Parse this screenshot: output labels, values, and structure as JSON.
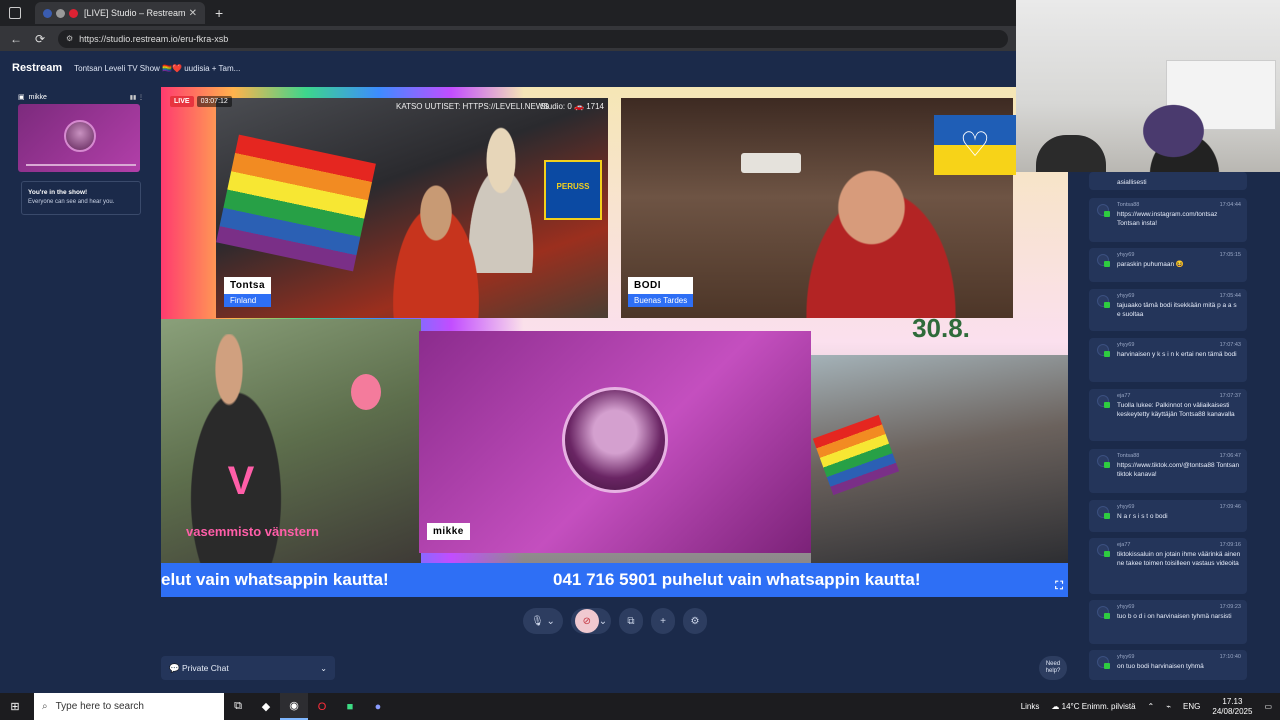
{
  "browser": {
    "tab_title": "[LIVE] Studio – Restream",
    "url": "https://studio.restream.io/eru-fkra-xsb"
  },
  "header": {
    "logo": "Restream",
    "show_title": "Tontsan Leveli TV Show 🏳️‍🌈❤️ uudisia + Tam..."
  },
  "sidebar": {
    "guest_name": "mikke",
    "note_title": "You're in the show!",
    "note_text": "Everyone can see and hear you."
  },
  "stage": {
    "live_label": "LIVE",
    "timer": "03:07:12",
    "tontsa_overlay": "KATSO UUTISET: HTTPS://LEVELI.NEWS",
    "tontsa_studio": "Studio: 0 🚗 1714",
    "perus_text": "PERUSS",
    "participants": [
      {
        "name": "Tontsa",
        "subtitle": "Finland"
      },
      {
        "name": "BODI",
        "subtitle": "Buenas Tardes"
      },
      {
        "name": "mikke",
        "subtitle": ""
      }
    ],
    "date_text": "30.8.",
    "logo_text": "vasemmisto vänstern",
    "ticker_left": "elut vain whatsappin kautta!",
    "ticker_right": "041 716 5901 puhelut vain whatsappin kautta!"
  },
  "controls": {
    "private_chat": "Private Chat",
    "need_help": "Need help?"
  },
  "chat": [
    {
      "user": "",
      "time": "",
      "text": "asiallisesti"
    },
    {
      "user": "Tontsa88",
      "time": "17:04:44",
      "text": "https://www.instagram.com/tontsaz Tontsan insta!"
    },
    {
      "user": "yhyy69",
      "time": "17:05:15",
      "text": "paraskin puhumaan 😆"
    },
    {
      "user": "yhyy69",
      "time": "17:05:44",
      "text": "tajuaako tämä bodi itsekkään mitä p a a s e suoltaa"
    },
    {
      "user": "yhyy69",
      "time": "17:07:43",
      "text": "harvinaisen y k s i n k ertai nen tämä bodi"
    },
    {
      "user": "eja77",
      "time": "17:07:37",
      "text": "Tuolla lukee: Palkinnot on väliaikaisesti keskeytetty käyttäjän Tontsa88 kanavalla"
    },
    {
      "user": "Tontsa88",
      "time": "17:06:47",
      "text": "https://www.tiktok.com/@tontsa88 Tontsan tiktok kanava!"
    },
    {
      "user": "yhyy69",
      "time": "17:09:46",
      "text": "N a r s i s t o bodi"
    },
    {
      "user": "eja77",
      "time": "17:09:16",
      "text": "tiktokissaluin on jotain ihme väärinkä ainen ne takee toimen toisilleen vastaus videoita"
    },
    {
      "user": "yhyy69",
      "time": "17:09:23",
      "text": "tuo b o d i on harvinaisen tyhmä narsisti"
    },
    {
      "user": "yhyy69",
      "time": "17:10:40",
      "text": "on tuo bodi harvinaisen tyhmä"
    }
  ],
  "taskbar": {
    "search_placeholder": "Type here to search",
    "links": "Links",
    "weather": "14°C Enimm. pilvistä",
    "lang": "ENG",
    "time": "17.13",
    "date": "24/08/2025"
  }
}
